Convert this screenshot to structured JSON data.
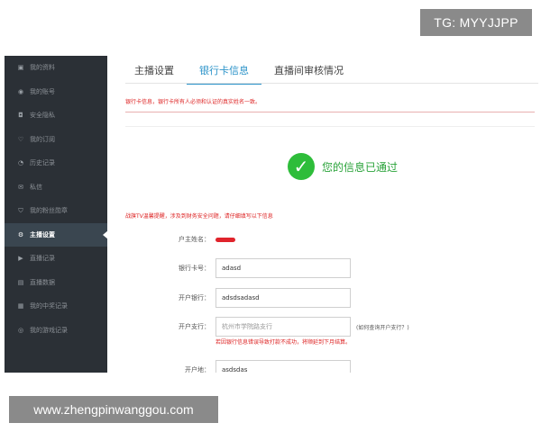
{
  "watermark": {
    "top": "TG: MYYJJPP",
    "bottom": "www.zhengpinwanggou.com"
  },
  "sidebar": {
    "items": [
      {
        "label": "我的资料",
        "icon": "id-card-icon",
        "glyph": "▣"
      },
      {
        "label": "我的账号",
        "icon": "user-circle-icon",
        "glyph": "◉"
      },
      {
        "label": "安全隐私",
        "icon": "camera-icon",
        "glyph": "◘"
      },
      {
        "label": "我的订阅",
        "icon": "heart-icon",
        "glyph": "♡"
      },
      {
        "label": "历史记录",
        "icon": "clock-icon",
        "glyph": "◔"
      },
      {
        "label": "私信",
        "icon": "message-icon",
        "glyph": "✉"
      },
      {
        "label": "我的粉丝勋章",
        "icon": "shield-icon",
        "glyph": "⛉"
      },
      {
        "label": "主播设置",
        "icon": "gear-icon",
        "glyph": "⚙"
      },
      {
        "label": "直播记录",
        "icon": "video-icon",
        "glyph": "▶"
      },
      {
        "label": "直播数据",
        "icon": "chart-icon",
        "glyph": "▤"
      },
      {
        "label": "我的中奖记录",
        "icon": "gift-icon",
        "glyph": "▦"
      },
      {
        "label": "我的游戏记录",
        "icon": "gamepad-icon",
        "glyph": "◎"
      }
    ],
    "active_index": 7
  },
  "tabs": [
    {
      "label": "主播设置"
    },
    {
      "label": "银行卡信息"
    },
    {
      "label": "直播间审核情况"
    }
  ],
  "notice": "银行卡信息，银行卡所有人必须和认证的真实姓名一致。",
  "success": {
    "text": "您的信息已通过"
  },
  "warning": "战旗TV温馨提醒，涉及到财务安全问题，请仔细填写以下信息",
  "form": {
    "holder_label": "户主姓名：",
    "card_label": "银行卡号：",
    "card_value": "adasd",
    "bank_label": "开户银行：",
    "bank_value": "adsdsadasd",
    "branch_label": "开户支行：",
    "branch_placeholder": "杭州市学院路支行",
    "branch_help": "(如何查询开户支行？)",
    "error": "若因银行信息错误导致打款不成功，将顺延到下月结算。",
    "address_label": "开户地：",
    "address_value": "asdsdas"
  }
}
